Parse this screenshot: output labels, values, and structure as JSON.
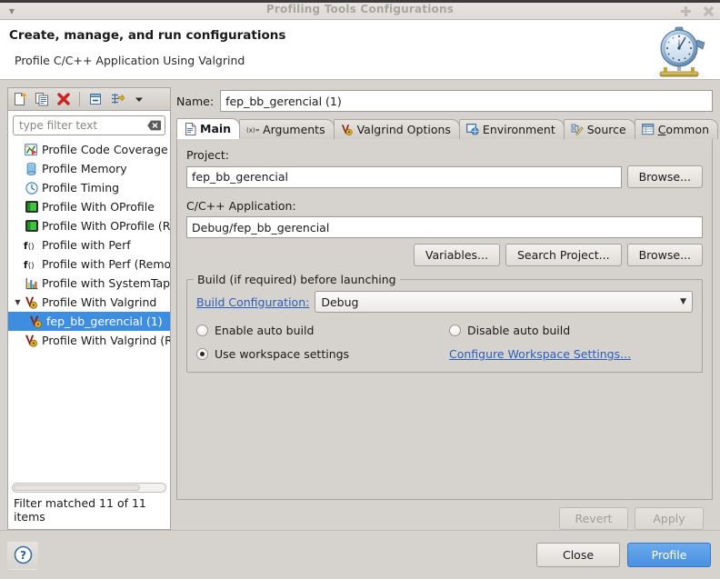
{
  "titlebar": {
    "title": "Profiling Tools Configurations",
    "menu_icon": "window-menu-icon",
    "maximize_icon": "maximize-icon",
    "close_icon": "close-icon"
  },
  "header": {
    "title": "Create, manage, and run configurations",
    "subtitle": "Profile C/C++ Application Using Valgrind",
    "image_icon": "stopwatch-icon"
  },
  "toolbar": {
    "items": [
      {
        "name": "new-configuration-icon",
        "tooltip": "New launch configuration"
      },
      {
        "name": "duplicate-configuration-icon",
        "tooltip": "Duplicate"
      },
      {
        "name": "delete-configuration-icon",
        "tooltip": "Delete"
      },
      {
        "name": "collapse-all-icon",
        "tooltip": "Collapse All"
      },
      {
        "name": "filter-configurations-icon",
        "tooltip": "Filter"
      },
      {
        "name": "view-menu-chevron-icon",
        "tooltip": "View Menu"
      }
    ]
  },
  "filter": {
    "placeholder": "type filter text",
    "value": "",
    "clear_icon": "clear-filter-icon",
    "status": "Filter matched 11 of 11 items"
  },
  "tree": {
    "items": [
      {
        "label": "Profile Code Coverage",
        "icon": "code-coverage-icon",
        "level": 0,
        "selected": false,
        "expandable": false
      },
      {
        "label": "Profile Memory",
        "icon": "memory-icon",
        "level": 0,
        "selected": false,
        "expandable": false
      },
      {
        "label": "Profile Timing",
        "icon": "timing-clock-icon",
        "level": 0,
        "selected": false,
        "expandable": false
      },
      {
        "label": "Profile With OProfile",
        "icon": "oprofile-icon",
        "level": 0,
        "selected": false,
        "expandable": false
      },
      {
        "label": "Profile With OProfile (Rem",
        "icon": "oprofile-icon",
        "level": 0,
        "selected": false,
        "expandable": false
      },
      {
        "label": "Profile with Perf",
        "icon": "perf-function-icon",
        "level": 0,
        "selected": false,
        "expandable": false
      },
      {
        "label": "Profile with Perf (Remote)",
        "icon": "perf-function-icon",
        "level": 0,
        "selected": false,
        "expandable": false
      },
      {
        "label": "Profile with SystemTap",
        "icon": "systemtap-chart-icon",
        "level": 0,
        "selected": false,
        "expandable": false
      },
      {
        "label": "Profile With Valgrind",
        "icon": "valgrind-icon",
        "level": 0,
        "selected": false,
        "expandable": true,
        "expanded": true
      },
      {
        "label": "fep_bb_gerencial (1)",
        "icon": "valgrind-icon",
        "level": 1,
        "selected": true,
        "expandable": false
      },
      {
        "label": "Profile With Valgrind (Rem",
        "icon": "valgrind-icon",
        "level": 0,
        "selected": false,
        "expandable": false
      }
    ]
  },
  "form": {
    "name_label": "Name:",
    "name_value": "fep_bb_gerencial (1)",
    "project_label": "Project:",
    "project_value": "fep_bb_gerencial",
    "project_browse_label": "Browse...",
    "application_label": "C/C++ Application:",
    "application_value": "Debug/fep_bb_gerencial",
    "variables_label": "Variables...",
    "search_project_label": "Search Project...",
    "application_browse_label": "Browse..."
  },
  "tabs": [
    {
      "label": "Main",
      "icon": "main-document-icon",
      "active": true
    },
    {
      "label": "Arguments",
      "icon": "arguments-icon",
      "active": false
    },
    {
      "label": "Valgrind Options",
      "icon": "valgrind-icon",
      "active": false
    },
    {
      "label": "Environment",
      "icon": "environment-icon",
      "active": false
    },
    {
      "label": "Source",
      "icon": "source-icon",
      "active": false
    },
    {
      "label": "Common",
      "icon": "common-icon",
      "active": false
    }
  ],
  "build_group": {
    "title": "Build (if required) before launching",
    "build_configuration_link": "Build Configuration:",
    "build_configuration_value": "Debug",
    "dropdown_arrow_icon": "chevron-down-icon",
    "radios": [
      {
        "label": "Enable auto build",
        "checked": false
      },
      {
        "label": "Disable auto build",
        "checked": false
      },
      {
        "label": "Use workspace settings",
        "checked": true
      }
    ],
    "configure_workspace_link": "Configure Workspace Settings..."
  },
  "actions": {
    "revert_label": "Revert",
    "revert_enabled": false,
    "apply_label": "Apply",
    "apply_enabled": false,
    "help_icon": "help-question-icon",
    "close_label": "Close",
    "profile_label": "Profile"
  },
  "colors": {
    "selection_blue": "#3d8de0",
    "primary_button": "#4a90e2",
    "link_blue": "#2b5fbe",
    "dialog_bg": "#d6d2cd",
    "valgrind_red": "#8e1b12"
  }
}
